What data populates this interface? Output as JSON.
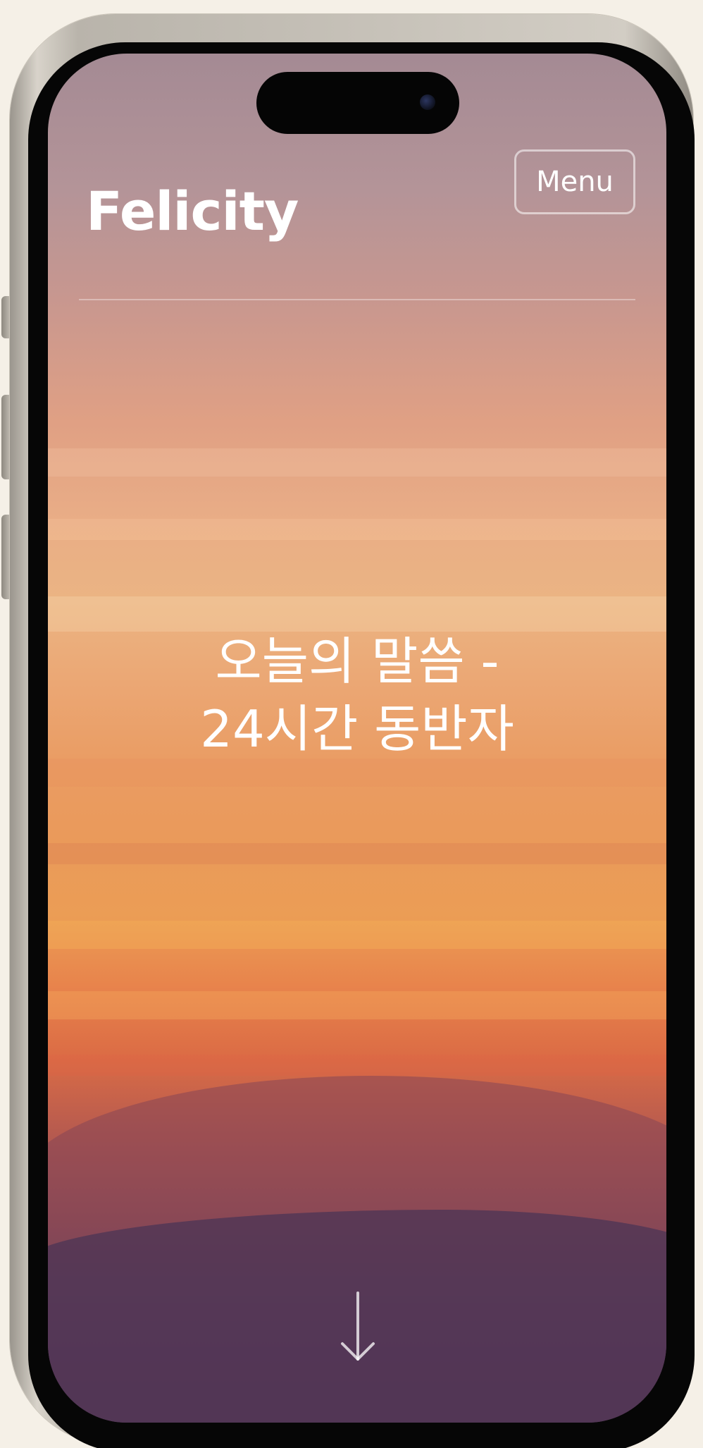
{
  "site": {
    "brand": "Felicity",
    "menu_label": "Menu"
  },
  "hero": {
    "title_line1": "오늘의 말씀 -",
    "title_line2": "24시간 동반자"
  },
  "icons": {
    "scroll": "arrow-down-icon",
    "camera": "front-camera-icon"
  },
  "colors": {
    "page_background": "#f5f0e7",
    "text": "#ffffff",
    "sky_top": "#a48a94",
    "sky_glow": "#eba774",
    "sky_bottom": "#3f3254"
  }
}
